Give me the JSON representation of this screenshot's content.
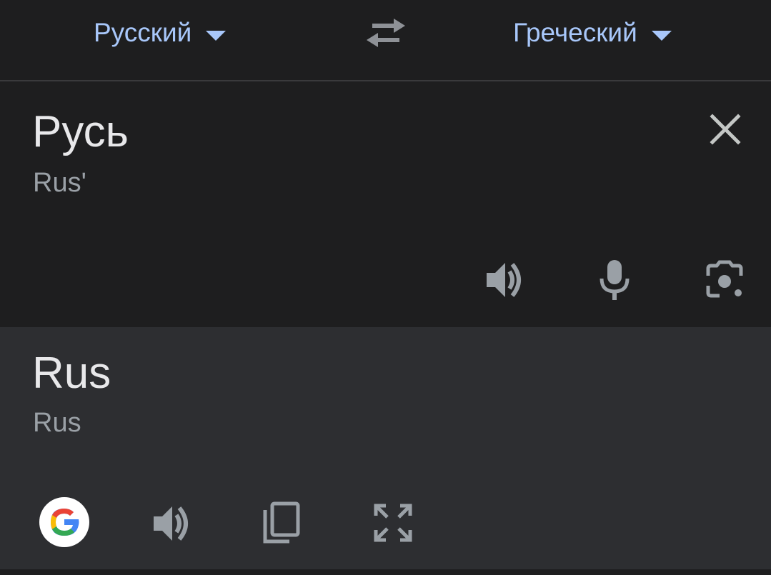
{
  "languages": {
    "source": "Русский",
    "target": "Греческий"
  },
  "source": {
    "text": "Русь",
    "transliteration": "Rus'"
  },
  "result": {
    "text": "Rus",
    "transliteration": "Rus"
  },
  "colors": {
    "accent": "#a8c7fa",
    "icon": "#9aa0a6",
    "text": "#e8e8ea",
    "background": "#1e1e1f",
    "result_background": "#2d2e31"
  },
  "icons": {
    "swap": "swap-icon",
    "clear": "close-icon",
    "source_listen": "speaker-icon",
    "mic": "microphone-icon",
    "camera": "camera-lens-icon",
    "google": "google-logo-icon",
    "result_listen": "speaker-icon",
    "copy": "copy-icon",
    "fullscreen": "fullscreen-icon"
  }
}
